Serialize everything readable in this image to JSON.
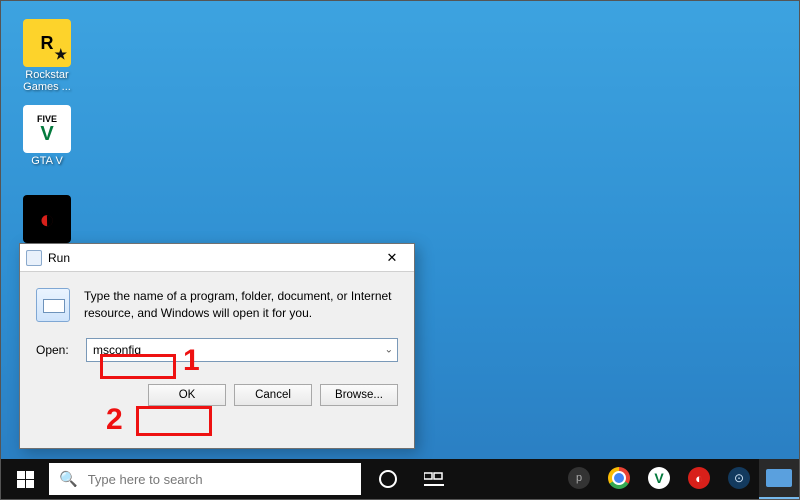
{
  "desktop": {
    "icons": [
      {
        "name": "rockstar-games-launcher",
        "label": "Rockstar Games ..."
      },
      {
        "name": "gta-v",
        "label": "GTA V"
      },
      {
        "name": "garena",
        "label": ""
      }
    ]
  },
  "run_dialog": {
    "title": "Run",
    "description": "Type the name of a program, folder, document, or Internet resource, and Windows will open it for you.",
    "open_label": "Open:",
    "open_value": "msconfig",
    "buttons": {
      "ok": "OK",
      "cancel": "Cancel",
      "browse": "Browse..."
    }
  },
  "annotations": {
    "step1": "1",
    "step2": "2"
  },
  "taskbar": {
    "search_placeholder": "Type here to search",
    "pinned": [
      "cortana",
      "task-view",
      "proto",
      "chrome",
      "gta-v",
      "garena",
      "steam",
      "run"
    ]
  }
}
